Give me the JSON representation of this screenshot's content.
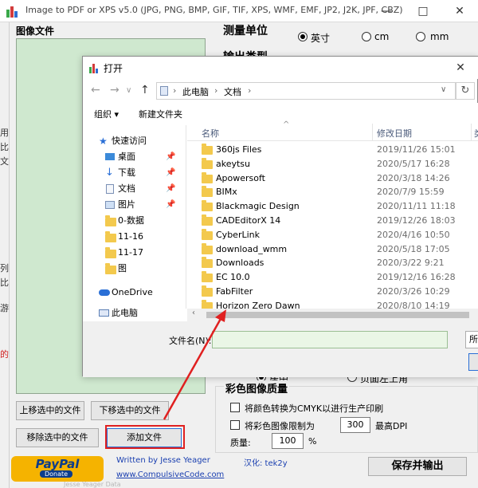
{
  "app": {
    "title": "Image to PDF or XPS  v5.0  (JPG, PNG, BMP, GIF, TIF, XPS, WMF, EMF, JP2, J2K, JPF, CBZ)",
    "window_controls": [
      "—",
      "□",
      "✕"
    ],
    "image_files_label": "图像文件",
    "left_edge_chars": [
      "用",
      "比",
      "文",
      "列",
      "比",
      "游",
      "的"
    ]
  },
  "units": {
    "title": "测量单位",
    "options": [
      {
        "label": "英寸",
        "selected": true
      },
      {
        "label": "cm",
        "selected": false
      },
      {
        "label": "mm",
        "selected": false
      }
    ]
  },
  "output_type": {
    "title": "输出类型"
  },
  "page_position": {
    "option1": "居中",
    "option2": "页面左上角"
  },
  "buttons": {
    "move_up": "上移选中的文件",
    "move_down": "下移选中的文件",
    "remove": "移除选中的文件",
    "add_file": "添加文件",
    "save_output": "保存并输出"
  },
  "color_quality": {
    "title": "彩色图像质量",
    "cmyk_label": "将颜色转换为CMYK以进行生产印刷",
    "cmyk_checked": false,
    "limit_label": "将彩色图像限制为",
    "limit_checked": false,
    "dpi_value": "300",
    "dpi_suffix": "最高DPI",
    "quality_label": "质量:",
    "quality_value": "100",
    "quality_unit": "%"
  },
  "paypal": {
    "logo": "PayPal",
    "donate": "Donate"
  },
  "credits": {
    "author": "Written by Jesse Yeager",
    "url": "www.CompulsiveCode.com",
    "translator": "汉化: tek2y",
    "faint": "Jesse Yeager Data"
  },
  "dialog": {
    "title": "打开",
    "close": "✕",
    "breadcrumb": [
      "此电脑",
      "文档"
    ],
    "back_icon": "←",
    "forward_icon": "→",
    "dropdown_icon": "∨",
    "up_icon": "↑",
    "refresh_icon": "↻",
    "toolbar": {
      "organize": "组织 ▾",
      "new_folder": "新建文件夹"
    },
    "nav_items": [
      {
        "label": "快速访问",
        "icon": "star-icon",
        "pinned": false
      },
      {
        "label": "桌面",
        "icon": "desktop-icon",
        "pinned": true
      },
      {
        "label": "下载",
        "icon": "download-icon",
        "pinned": true
      },
      {
        "label": "文档",
        "icon": "document-icon",
        "pinned": true
      },
      {
        "label": "图片",
        "icon": "picture-icon",
        "pinned": true
      },
      {
        "label": "0-数据",
        "icon": "folder-icon",
        "pinned": false
      },
      {
        "label": "11-16",
        "icon": "folder-icon",
        "pinned": false
      },
      {
        "label": "11-17",
        "icon": "folder-icon",
        "pinned": false
      },
      {
        "label": "图",
        "icon": "folder-icon",
        "pinned": false
      },
      {
        "label": "OneDrive",
        "icon": "cloud-icon",
        "pinned": false
      },
      {
        "label": "此电脑",
        "icon": "computer-icon",
        "pinned": false
      }
    ],
    "columns": {
      "name": "名称",
      "date": "修改日期",
      "type": "类"
    },
    "files": [
      {
        "name": "360js Files",
        "date": "2019/11/26 15:01"
      },
      {
        "name": "akeytsu",
        "date": "2020/5/17 16:28"
      },
      {
        "name": "Apowersoft",
        "date": "2020/3/18 14:26"
      },
      {
        "name": "BIMx",
        "date": "2020/7/9 15:59"
      },
      {
        "name": "Blackmagic Design",
        "date": "2020/11/11 11:18"
      },
      {
        "name": "CADEditorX 14",
        "date": "2019/12/26 18:03"
      },
      {
        "name": "CyberLink",
        "date": "2020/4/16 10:50"
      },
      {
        "name": "download_wmm",
        "date": "2020/5/18 17:05"
      },
      {
        "name": "Downloads",
        "date": "2020/3/22 9:21"
      },
      {
        "name": "EC 10.0",
        "date": "2019/12/16 16:28"
      },
      {
        "name": "FabFilter",
        "date": "2020/3/26 10:29"
      },
      {
        "name": "Horizon Zero Dawn",
        "date": "2020/8/10 14:19"
      }
    ],
    "filename_label": "文件名(N):",
    "filename_value": "",
    "filetype_value": "所"
  }
}
